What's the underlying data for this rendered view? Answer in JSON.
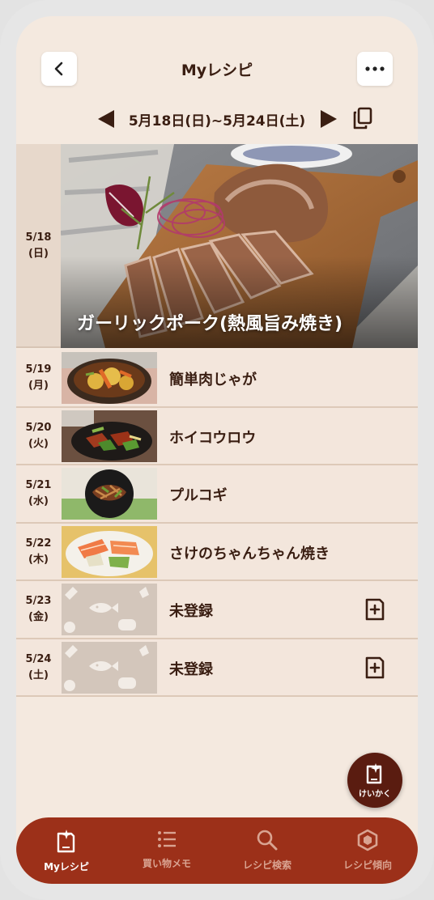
{
  "header": {
    "title": "Myレシピ"
  },
  "week": {
    "label": "5月18日(日)~5月24日(土)"
  },
  "hero": {
    "date": "5/18",
    "weekday": "(日)",
    "recipe": "ガーリックポーク(熱風旨み焼き)"
  },
  "rows": [
    {
      "date": "5/19",
      "weekday": "(月)",
      "name": "簡単肉じゃが",
      "photo": "nikujaga"
    },
    {
      "date": "5/20",
      "weekday": "(火)",
      "name": "ホイコウロウ",
      "photo": "hoikoro"
    },
    {
      "date": "5/21",
      "weekday": "(水)",
      "name": "プルコギ",
      "photo": "bulgogi"
    },
    {
      "date": "5/22",
      "weekday": "(木)",
      "name": "さけのちゃんちゃん焼き",
      "photo": "salmon"
    },
    {
      "date": "5/23",
      "weekday": "(金)",
      "name": "未登録",
      "photo": "placeholder"
    },
    {
      "date": "5/24",
      "weekday": "(土)",
      "name": "未登録",
      "photo": "placeholder"
    }
  ],
  "fab": {
    "label": "けいかく",
    "icon": "sparkle-book-icon"
  },
  "tabs": [
    {
      "label": "Myレシピ",
      "icon": "book-plus-icon",
      "active": true
    },
    {
      "label": "買い物メモ",
      "icon": "list-icon",
      "active": false
    },
    {
      "label": "レシピ検索",
      "icon": "search-icon",
      "active": false
    },
    {
      "label": "レシピ傾向",
      "icon": "hexagon-icon",
      "active": false
    }
  ],
  "colors": {
    "accent": "#9c3019",
    "text": "#3a1e12",
    "background": "#f4e9df",
    "fab": "#5a1c10"
  }
}
